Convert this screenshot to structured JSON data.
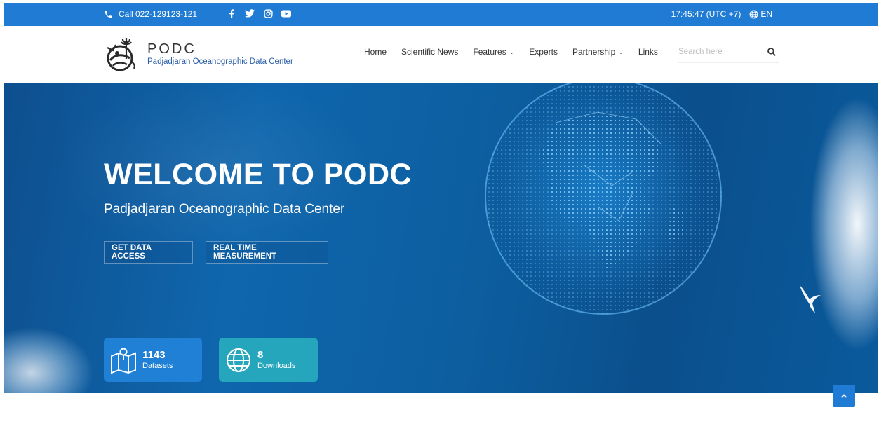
{
  "topbar": {
    "call_label": "Call 022-129123-121",
    "icons": [
      "phone-icon",
      "facebook-icon",
      "twitter-icon",
      "instagram-icon",
      "youtube-icon",
      "globe-icon"
    ],
    "clock": "17:45:47 (UTC +7)",
    "language": "EN"
  },
  "header": {
    "logo_title": "PODC",
    "logo_subtitle": "Padjadjaran Oceanographic Data Center",
    "nav": [
      {
        "label": "Home",
        "dropdown": false
      },
      {
        "label": "Scientific News",
        "dropdown": false
      },
      {
        "label": "Features",
        "dropdown": true
      },
      {
        "label": "Experts",
        "dropdown": false
      },
      {
        "label": "Partnership",
        "dropdown": true
      },
      {
        "label": "Links",
        "dropdown": false
      }
    ],
    "search_placeholder": "Search here"
  },
  "hero": {
    "title": "WELCOME TO PODC",
    "subtitle": "Padjadjaran Oceanographic Data Center",
    "buttons": {
      "data_access": "GET DATA ACCESS",
      "realtime": "REAL TIME MEASUREMENT"
    },
    "stats": [
      {
        "value": "1143",
        "label": "Datasets",
        "icon": "map-pin-icon"
      },
      {
        "value": "8",
        "label": "Downloads",
        "icon": "globe-icon"
      }
    ]
  },
  "colors": {
    "primary": "#1f7bd4",
    "teal": "#25a6bd",
    "hero_bg": "#0f66ad"
  }
}
